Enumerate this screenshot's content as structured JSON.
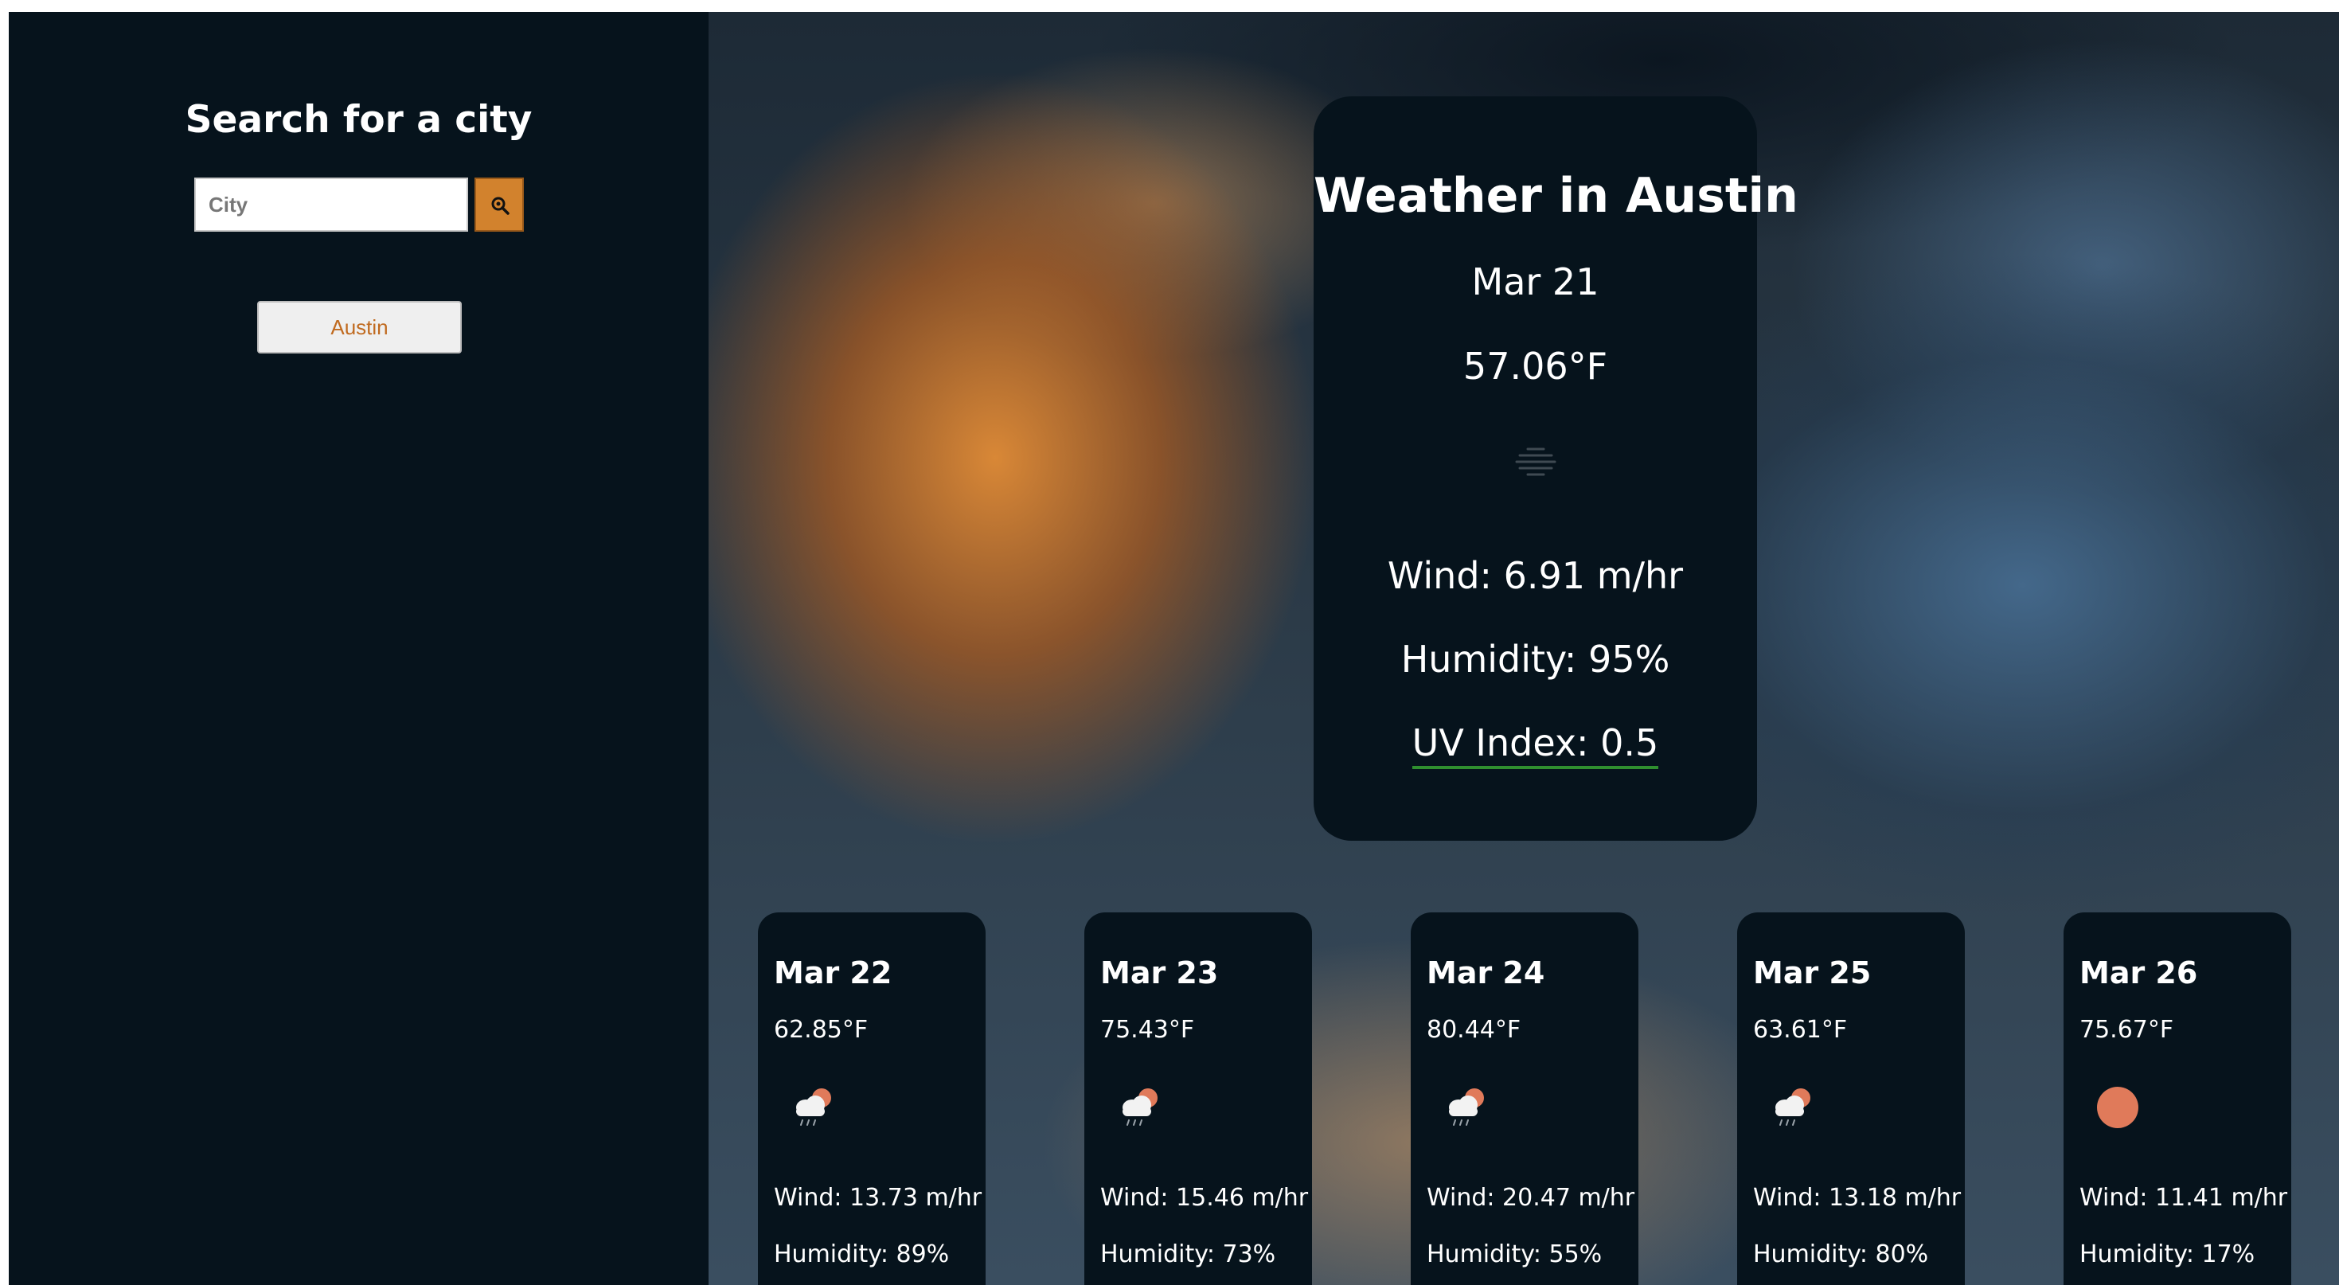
{
  "sidebar": {
    "title": "Search for a city",
    "search": {
      "placeholder": "City",
      "value": "",
      "button_icon": "search-icon"
    },
    "history": [
      "Austin"
    ]
  },
  "current": {
    "title": "Weather in Austin",
    "date": "Mar 21",
    "temp": "57.06°F",
    "icon": "mist-icon",
    "wind": "Wind: 6.91 m/hr",
    "humidity": "Humidity: 95%",
    "uv": "UV Index: 0.5",
    "uv_indicator_color": "#2f8f2f"
  },
  "forecast": [
    {
      "date": "Mar 22",
      "temp": "62.85°F",
      "icon": "rain-cloud-sun-icon",
      "wind": "Wind: 13.73 m/hr",
      "humidity": "Humidity: 89%"
    },
    {
      "date": "Mar 23",
      "temp": "75.43°F",
      "icon": "rain-cloud-sun-icon",
      "wind": "Wind: 15.46 m/hr",
      "humidity": "Humidity: 73%"
    },
    {
      "date": "Mar 24",
      "temp": "80.44°F",
      "icon": "rain-cloud-sun-icon",
      "wind": "Wind: 20.47 m/hr",
      "humidity": "Humidity: 55%"
    },
    {
      "date": "Mar 25",
      "temp": "63.61°F",
      "icon": "rain-cloud-sun-icon",
      "wind": "Wind: 13.18 m/hr",
      "humidity": "Humidity: 80%"
    },
    {
      "date": "Mar 26",
      "temp": "75.67°F",
      "icon": "sun-icon",
      "wind": "Wind: 11.41 m/hr",
      "humidity": "Humidity: 17%"
    }
  ],
  "colors": {
    "panel": "#06131c",
    "accent": "#d2822d",
    "history_text": "#c06a1f",
    "sun": "#e07a5a"
  }
}
